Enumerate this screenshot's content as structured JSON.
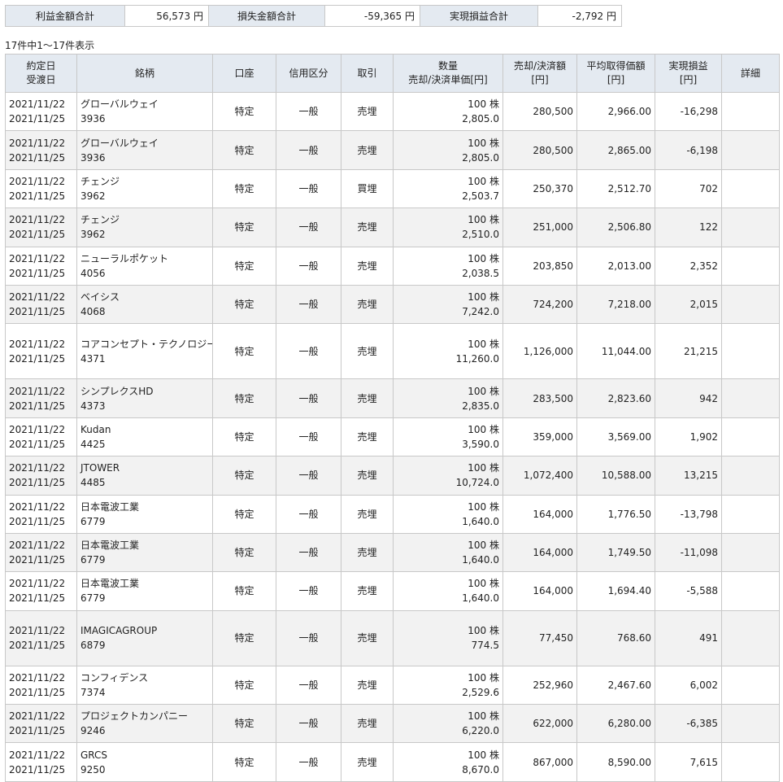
{
  "summary": {
    "profit_label": "利益金額合計",
    "profit_value": "56,573 円",
    "loss_label": "損失金額合計",
    "loss_value": "-59,365 円",
    "realized_label": "実現損益合計",
    "realized_value": "-2,792 円"
  },
  "count_text": "17件中1～17件表示",
  "headers": {
    "date1": "約定日",
    "date2": "受渡日",
    "stock": "銘柄",
    "account": "口座",
    "credit": "信用区分",
    "trade": "取引",
    "qty1": "数量",
    "qty2": "売却/決済単価[円]",
    "amount1": "売却/決済額",
    "amount2": "[円]",
    "avg1": "平均取得価額",
    "avg2": "[円]",
    "pl1": "実現損益",
    "pl2": "[円]",
    "detail": "詳細"
  },
  "rows": [
    {
      "contract": "2021/11/22",
      "settle": "2021/11/25",
      "name": "グローバルウェイ",
      "code": "3936",
      "account": "特定",
      "credit": "一般",
      "trade": "売埋",
      "qty": "100 株",
      "price": "2,805.0",
      "amount": "280,500",
      "avg": "2,966.00",
      "pl": "-16,298"
    },
    {
      "contract": "2021/11/22",
      "settle": "2021/11/25",
      "name": "グローバルウェイ",
      "code": "3936",
      "account": "特定",
      "credit": "一般",
      "trade": "売埋",
      "qty": "100 株",
      "price": "2,805.0",
      "amount": "280,500",
      "avg": "2,865.00",
      "pl": "-6,198"
    },
    {
      "contract": "2021/11/22",
      "settle": "2021/11/25",
      "name": "チェンジ",
      "code": "3962",
      "account": "特定",
      "credit": "一般",
      "trade": "買埋",
      "qty": "100 株",
      "price": "2,503.7",
      "amount": "250,370",
      "avg": "2,512.70",
      "pl": "702"
    },
    {
      "contract": "2021/11/22",
      "settle": "2021/11/25",
      "name": "チェンジ",
      "code": "3962",
      "account": "特定",
      "credit": "一般",
      "trade": "売埋",
      "qty": "100 株",
      "price": "2,510.0",
      "amount": "251,000",
      "avg": "2,506.80",
      "pl": "122"
    },
    {
      "contract": "2021/11/22",
      "settle": "2021/11/25",
      "name": "ニューラルポケット",
      "code": "4056",
      "account": "特定",
      "credit": "一般",
      "trade": "売埋",
      "qty": "100 株",
      "price": "2,038.5",
      "amount": "203,850",
      "avg": "2,013.00",
      "pl": "2,352"
    },
    {
      "contract": "2021/11/22",
      "settle": "2021/11/25",
      "name": "ベイシス",
      "code": "4068",
      "account": "特定",
      "credit": "一般",
      "trade": "売埋",
      "qty": "100 株",
      "price": "7,242.0",
      "amount": "724,200",
      "avg": "7,218.00",
      "pl": "2,015"
    },
    {
      "contract": "2021/11/22",
      "settle": "2021/11/25",
      "name": "コアコンセプト・テクノロジー",
      "code": "4371",
      "account": "特定",
      "credit": "一般",
      "trade": "売埋",
      "qty": "100 株",
      "price": "11,260.0",
      "amount": "1,126,000",
      "avg": "11,044.00",
      "pl": "21,215"
    },
    {
      "contract": "2021/11/22",
      "settle": "2021/11/25",
      "name": "シンプレクスHD",
      "code": "4373",
      "account": "特定",
      "credit": "一般",
      "trade": "売埋",
      "qty": "100 株",
      "price": "2,835.0",
      "amount": "283,500",
      "avg": "2,823.60",
      "pl": "942"
    },
    {
      "contract": "2021/11/22",
      "settle": "2021/11/25",
      "name": "Kudan",
      "code": "4425",
      "account": "特定",
      "credit": "一般",
      "trade": "売埋",
      "qty": "100 株",
      "price": "3,590.0",
      "amount": "359,000",
      "avg": "3,569.00",
      "pl": "1,902"
    },
    {
      "contract": "2021/11/22",
      "settle": "2021/11/25",
      "name": "JTOWER",
      "code": "4485",
      "account": "特定",
      "credit": "一般",
      "trade": "売埋",
      "qty": "100 株",
      "price": "10,724.0",
      "amount": "1,072,400",
      "avg": "10,588.00",
      "pl": "13,215"
    },
    {
      "contract": "2021/11/22",
      "settle": "2021/11/25",
      "name": "日本電波工業",
      "code": "6779",
      "account": "特定",
      "credit": "一般",
      "trade": "売埋",
      "qty": "100 株",
      "price": "1,640.0",
      "amount": "164,000",
      "avg": "1,776.50",
      "pl": "-13,798"
    },
    {
      "contract": "2021/11/22",
      "settle": "2021/11/25",
      "name": "日本電波工業",
      "code": "6779",
      "account": "特定",
      "credit": "一般",
      "trade": "売埋",
      "qty": "100 株",
      "price": "1,640.0",
      "amount": "164,000",
      "avg": "1,749.50",
      "pl": "-11,098"
    },
    {
      "contract": "2021/11/22",
      "settle": "2021/11/25",
      "name": "日本電波工業",
      "code": "6779",
      "account": "特定",
      "credit": "一般",
      "trade": "売埋",
      "qty": "100 株",
      "price": "1,640.0",
      "amount": "164,000",
      "avg": "1,694.40",
      "pl": "-5,588"
    },
    {
      "contract": "2021/11/22",
      "settle": "2021/11/25",
      "name": "IMAGICAGROUP",
      "code": "6879",
      "account": "特定",
      "credit": "一般",
      "trade": "売埋",
      "qty": "100 株",
      "price": "774.5",
      "amount": "77,450",
      "avg": "768.60",
      "pl": "491"
    },
    {
      "contract": "2021/11/22",
      "settle": "2021/11/25",
      "name": "コンフィデンス",
      "code": "7374",
      "account": "特定",
      "credit": "一般",
      "trade": "売埋",
      "qty": "100 株",
      "price": "2,529.6",
      "amount": "252,960",
      "avg": "2,467.60",
      "pl": "6,002"
    },
    {
      "contract": "2021/11/22",
      "settle": "2021/11/25",
      "name": "プロジェクトカンパニー",
      "code": "9246",
      "account": "特定",
      "credit": "一般",
      "trade": "売埋",
      "qty": "100 株",
      "price": "6,220.0",
      "amount": "622,000",
      "avg": "6,280.00",
      "pl": "-6,385"
    },
    {
      "contract": "2021/11/22",
      "settle": "2021/11/25",
      "name": "GRCS",
      "code": "9250",
      "account": "特定",
      "credit": "一般",
      "trade": "売埋",
      "qty": "100 株",
      "price": "8,670.0",
      "amount": "867,000",
      "avg": "8,590.00",
      "pl": "7,615"
    }
  ]
}
